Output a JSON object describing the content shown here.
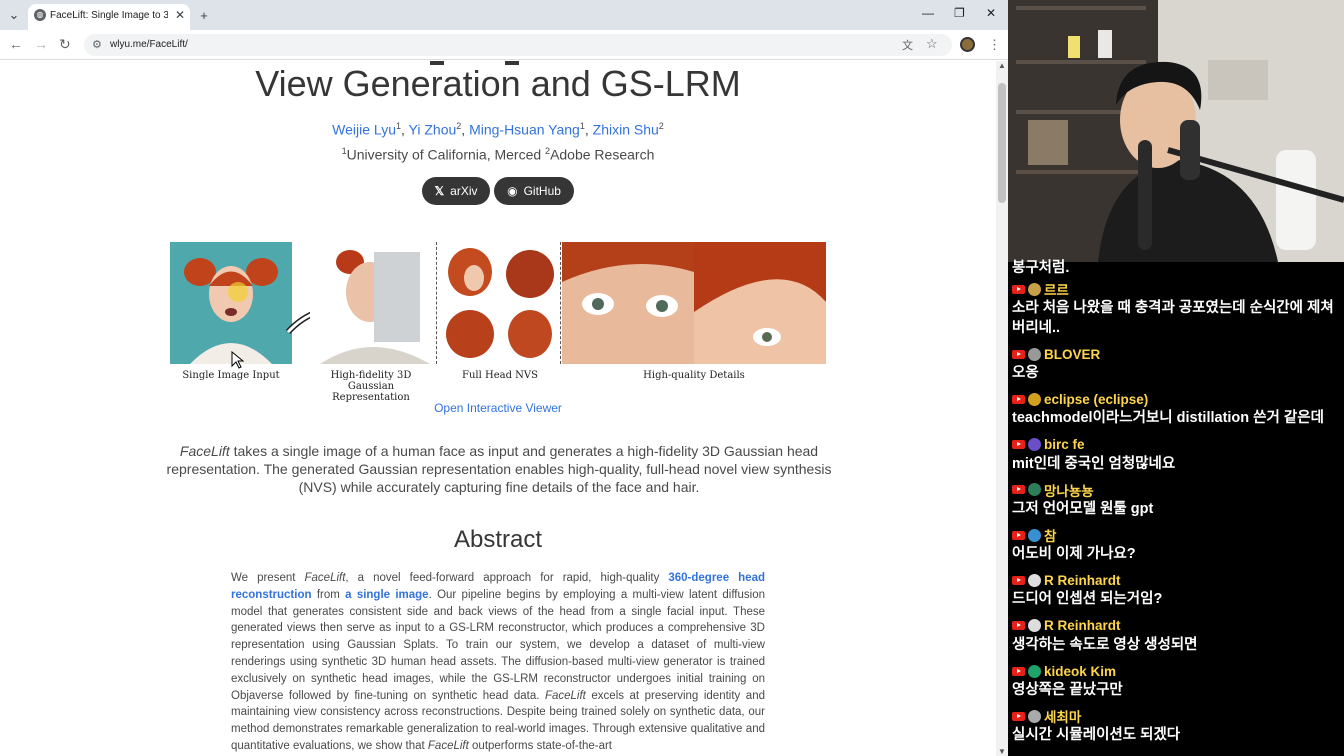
{
  "browser": {
    "tab_title": "FaceLift: Single Image to 3D H",
    "url": "wlyu.me/FaceLift/"
  },
  "page": {
    "title_line2": "View Generation and GS-LRM",
    "authors": [
      {
        "name": "Weijie Lyu",
        "sup": "1"
      },
      {
        "name": "Yi Zhou",
        "sup": "2"
      },
      {
        "name": "Ming-Hsuan Yang",
        "sup": "1"
      },
      {
        "name": "Zhixin Shu",
        "sup": "2"
      }
    ],
    "affil_sup1": "1",
    "affil1": "University of California, Merced",
    "affil_sup2": "2",
    "affil2": "Adobe Research",
    "btn_arxiv": "arXiv",
    "btn_github": "GitHub",
    "captions": {
      "c1": "Single Image Input",
      "c2a": "High-fidelity 3D Gaussian",
      "c2b": "Representation",
      "c3": "Full Head NVS",
      "c4": "High-quality Details"
    },
    "viewer_link": "Open Interactive Viewer",
    "summary_em": "FaceLift",
    "summary": " takes a single image of a human face as input and generates a high-fidelity 3D Gaussian head representation. The generated Gaussian representation enables high-quality, full-head novel view synthesis (NVS) while accurately capturing fine details of the face and hair.",
    "abstract_heading": "Abstract",
    "abstract": {
      "p1": "We present ",
      "em1": "FaceLift",
      "p2": ", a novel feed-forward approach for rapid, high-quality ",
      "link1": "360-degree head reconstruction",
      "p3": " from ",
      "link2": "a single image",
      "p4": ". Our pipeline begins by employing a multi-view latent diffusion model that generates consistent side and back views of the head from a single facial input. These generated views then serve as input to a GS-LRM reconstructor, which produces a comprehensive 3D representation using Gaussian Splats. To train our system, we develop a dataset of multi-view renderings using synthetic 3D human head assets. The diffusion-based multi-view generator is trained exclusively on synthetic head images, while the GS-LRM reconstructor undergoes initial training on Objaverse followed by fine-tuning on synthetic head data. ",
      "em2": "FaceLift",
      "p5": " excels at preserving identity and maintaining view consistency across reconstructions. Despite being trained solely on synthetic data, our method demonstrates remarkable generalization to real-world images. Through extensive qualitative and quantitative evaluations, we show that ",
      "em3": "FaceLift",
      "p6": " outperforms state-of-the-art"
    }
  },
  "chat": {
    "partial_top": "봉구처럼.",
    "messages": [
      {
        "user": "르르",
        "text": "소라 처음 나왔을 때 충격과 공포였는데 순식간에 제쳐",
        "text2": "버리네..",
        "avatar": "#c8a04a"
      },
      {
        "user": "BLOVER",
        "text": "오옹",
        "avatar": "#999999"
      },
      {
        "user": "eclipse (eclipse)",
        "text": "teachmodel이라느거보니 distillation 쓴거 같은데",
        "avatar": "#d4a020"
      },
      {
        "user": "birc fe",
        "text": "mit인데 중국인 엄청많네요",
        "avatar": "#6a4fc8"
      },
      {
        "user": "망나뇽뇽",
        "text": "그저 언어모델 원툴 gpt",
        "avatar": "#2e7d5b"
      },
      {
        "user": "참",
        "text": "어도비 이제 가나요?",
        "avatar": "#3a8fd0"
      },
      {
        "user": "R Reinhardt",
        "text": "드디어 인셉션 되는거임?",
        "avatar": "#dddddd"
      },
      {
        "user": "R Reinhardt",
        "text": "생각하는 속도로 영상 생성되면",
        "avatar": "#dddddd"
      },
      {
        "user": "kideok Kim",
        "text": "영상쪽은 끝났구만",
        "avatar": "#1fa36b"
      },
      {
        "user": "세최마",
        "text": "실시간 시뮬레이션도 되겠다",
        "avatar": "#aaaaaa"
      }
    ]
  },
  "colors": {
    "link": "#3273dc",
    "chat_user": "#ffd54a",
    "tab_bar": "#dee3ea"
  }
}
